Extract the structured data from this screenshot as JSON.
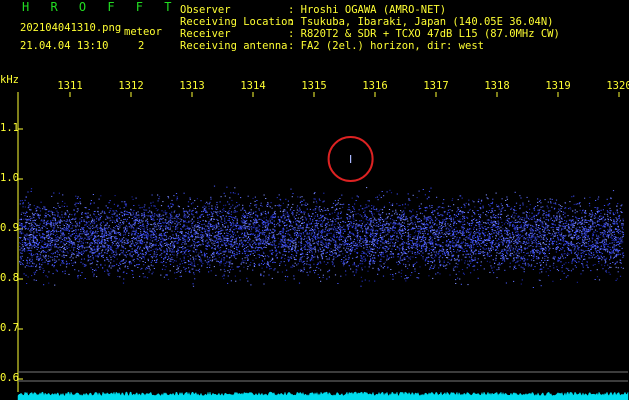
{
  "header": {
    "title": "H R O F F T",
    "file_name": "202104041310.png",
    "event_type": "meteor",
    "datetime": "21.04.04 13:10",
    "event_count": "2",
    "info": [
      {
        "label": "Observer",
        "value": ": Hroshi OGAWA (AMRO-NET)"
      },
      {
        "label": "Receiving Location",
        "value": ": Tsukuba, Ibaraki, Japan (140.05E 36.04N)"
      },
      {
        "label": "Receiver",
        "value": ": R820T2 & SDR + TCXO 47dB L15 (87.0MHz CW)"
      },
      {
        "label": "Receiving antenna",
        "value": ": FA2 (2el.) horizon, dir: west"
      }
    ]
  },
  "chart_data": {
    "type": "heatmap",
    "title": "",
    "ylabel": "kHz",
    "xlabel": "",
    "x_ticks": [
      "1311",
      "1312",
      "1313",
      "1314",
      "1315",
      "1316",
      "1317",
      "1318",
      "1319",
      "1320"
    ],
    "y_ticks": [
      "1.1",
      "1.0",
      "0.9",
      "0.8",
      "0.7",
      "0.6"
    ],
    "ylim": [
      0.58,
      1.15
    ],
    "noise_band_khz": [
      0.79,
      0.98
    ],
    "meteor_echo": {
      "time": "1315.6",
      "freq_khz": 1.04,
      "highlighted": true
    },
    "colors": {
      "noise": "#3a4cff",
      "echo": "#aab8ff",
      "highlight": "#dd2222",
      "axis": "#ffff33",
      "baseline": "#00ddee"
    }
  }
}
